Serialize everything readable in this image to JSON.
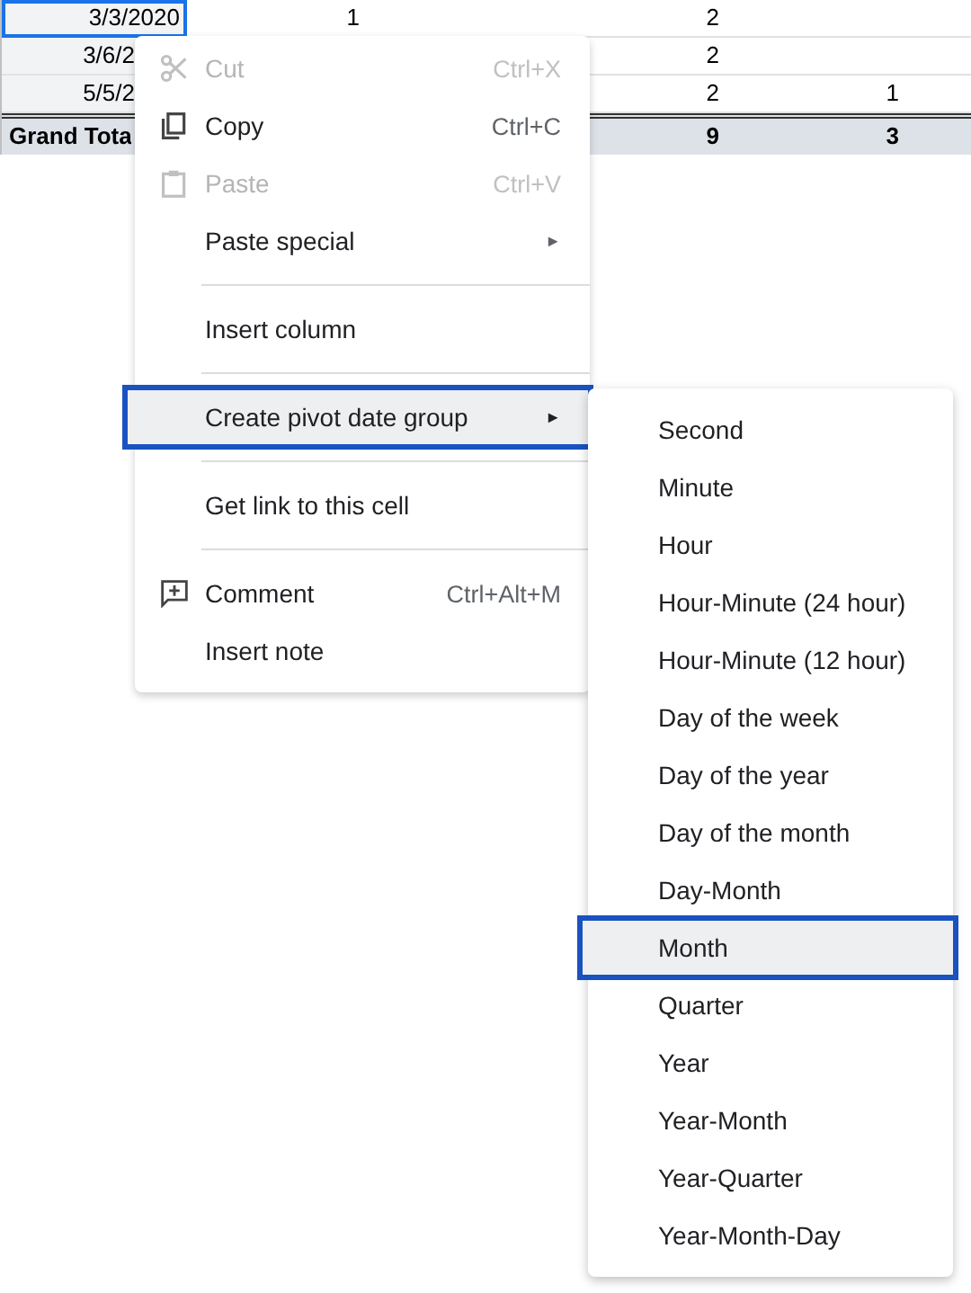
{
  "sheet": {
    "rows": [
      {
        "kind": "data",
        "selected": true,
        "label": "3/3/2020",
        "column_2": "1",
        "column_4": "2"
      },
      {
        "kind": "data",
        "selected": false,
        "label": "3/6/2",
        "column_4": "2"
      },
      {
        "kind": "data",
        "selected": false,
        "label": "5/5/2",
        "column_4": "2",
        "column_5": "1"
      },
      {
        "kind": "total",
        "selected": false,
        "label": "Grand Tota",
        "column_4": "9",
        "column_5": "3"
      }
    ]
  },
  "context_menu": {
    "items": [
      {
        "kind": "item",
        "label": "Cut",
        "shortcut": "Ctrl+X",
        "disabled": true,
        "selected": false
      },
      {
        "kind": "item",
        "label": "Copy",
        "shortcut": "Ctrl+C",
        "disabled": false,
        "selected": false
      },
      {
        "kind": "item",
        "label": "Paste",
        "shortcut": "Ctrl+V",
        "disabled": true,
        "selected": false
      },
      {
        "kind": "item",
        "label": "Paste special",
        "arrow": "►",
        "disabled": false,
        "selected": false
      },
      {
        "kind": "divider"
      },
      {
        "kind": "item",
        "label": "Insert column",
        "disabled": false,
        "selected": false
      },
      {
        "kind": "divider"
      },
      {
        "kind": "item",
        "label": "Create pivot date group",
        "arrow": "►",
        "disabled": false,
        "selected": true
      },
      {
        "kind": "divider"
      },
      {
        "kind": "item",
        "label": "Get link to this cell",
        "disabled": false,
        "selected": false
      },
      {
        "kind": "divider"
      },
      {
        "kind": "item",
        "label": "Comment",
        "shortcut": "Ctrl+Alt+M",
        "disabled": false,
        "selected": false
      },
      {
        "kind": "item",
        "label": "Insert note",
        "disabled": false,
        "selected": false
      }
    ]
  },
  "submenu": {
    "items": [
      {
        "label": "Second",
        "selected": false
      },
      {
        "label": "Minute",
        "selected": false
      },
      {
        "label": "Hour",
        "selected": false
      },
      {
        "label": "Hour-Minute (24 hour)",
        "selected": false
      },
      {
        "label": "Hour-Minute (12 hour)",
        "selected": false
      },
      {
        "label": "Day of the week",
        "selected": false
      },
      {
        "label": "Day of the year",
        "selected": false
      },
      {
        "label": "Day of the month",
        "selected": false
      },
      {
        "label": "Day-Month",
        "selected": false
      },
      {
        "label": "Month",
        "selected": true
      },
      {
        "label": "Quarter",
        "selected": false
      },
      {
        "label": "Year",
        "selected": false
      },
      {
        "label": "Year-Month",
        "selected": false
      },
      {
        "label": "Year-Quarter",
        "selected": false
      },
      {
        "label": "Year-Month-Day",
        "selected": false
      }
    ]
  }
}
